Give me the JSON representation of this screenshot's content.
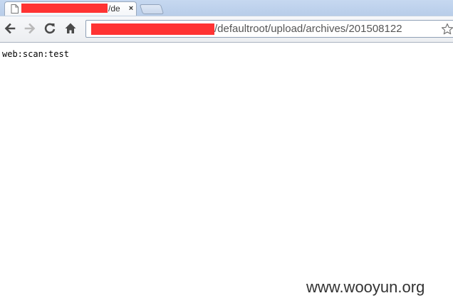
{
  "browser": {
    "tab": {
      "title_suffix": "/de",
      "close_glyph": "×",
      "favicon": "page-icon"
    },
    "toolbar": {
      "back_icon": "back-arrow-icon",
      "forward_icon": "forward-arrow-icon",
      "reload_icon": "reload-icon",
      "home_icon": "home-icon",
      "bookmark_icon": "star-icon"
    },
    "address": {
      "url_suffix": "/defaultroot/upload/archives/201508122"
    },
    "redaction_color": "#ff3333"
  },
  "page": {
    "body_text": "web:scan:test"
  },
  "watermark": {
    "text": "www.wooyun.org"
  }
}
